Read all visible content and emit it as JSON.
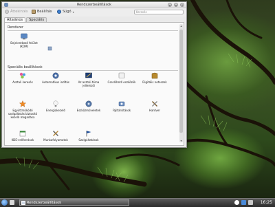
{
  "window": {
    "title": "Rendszerbeállítások",
    "toolbar": {
      "back_label": "Áttekintés",
      "settings_label": "Beállítás",
      "help_label": "Súgó",
      "search_placeholder": "Keresés"
    },
    "tabs": [
      {
        "label": "Általános"
      },
      {
        "label": "Speciális"
      }
    ],
    "sections": [
      {
        "title": "Rendszer",
        "items": [
          {
            "label": "Bejelentkező felület (KDM)"
          }
        ]
      },
      {
        "title": "Speciális beállítások",
        "items": [
          {
            "label": "Asztali keresés"
          },
          {
            "label": "Automatikus indítás"
          },
          {
            "label": "Az asztali téma jellemzői"
          },
          {
            "label": "Cserélhető eszközök"
          },
          {
            "label": "Digitális noteszek"
          },
          {
            "label": "Együttműködő szolgáltatás biztosító kezelő megadása"
          },
          {
            "label": "Energiakezelő"
          },
          {
            "label": "Eszközműveletek"
          },
          {
            "label": "Fájltársítások"
          },
          {
            "label": "Hardver"
          },
          {
            "label": "KDE-erőforrások"
          },
          {
            "label": "Munkafolyamatok"
          },
          {
            "label": "Szolgáltatások"
          }
        ]
      }
    ]
  },
  "taskbar": {
    "task_label": "Rendszerbeállítások",
    "clock": "16:25"
  },
  "icons": {
    "app_menu": "settings-icon",
    "back": "arrow-left-icon",
    "settings": "wrench-icon",
    "help": "help-icon"
  },
  "colors": {
    "accent": "#2f6ec2"
  }
}
